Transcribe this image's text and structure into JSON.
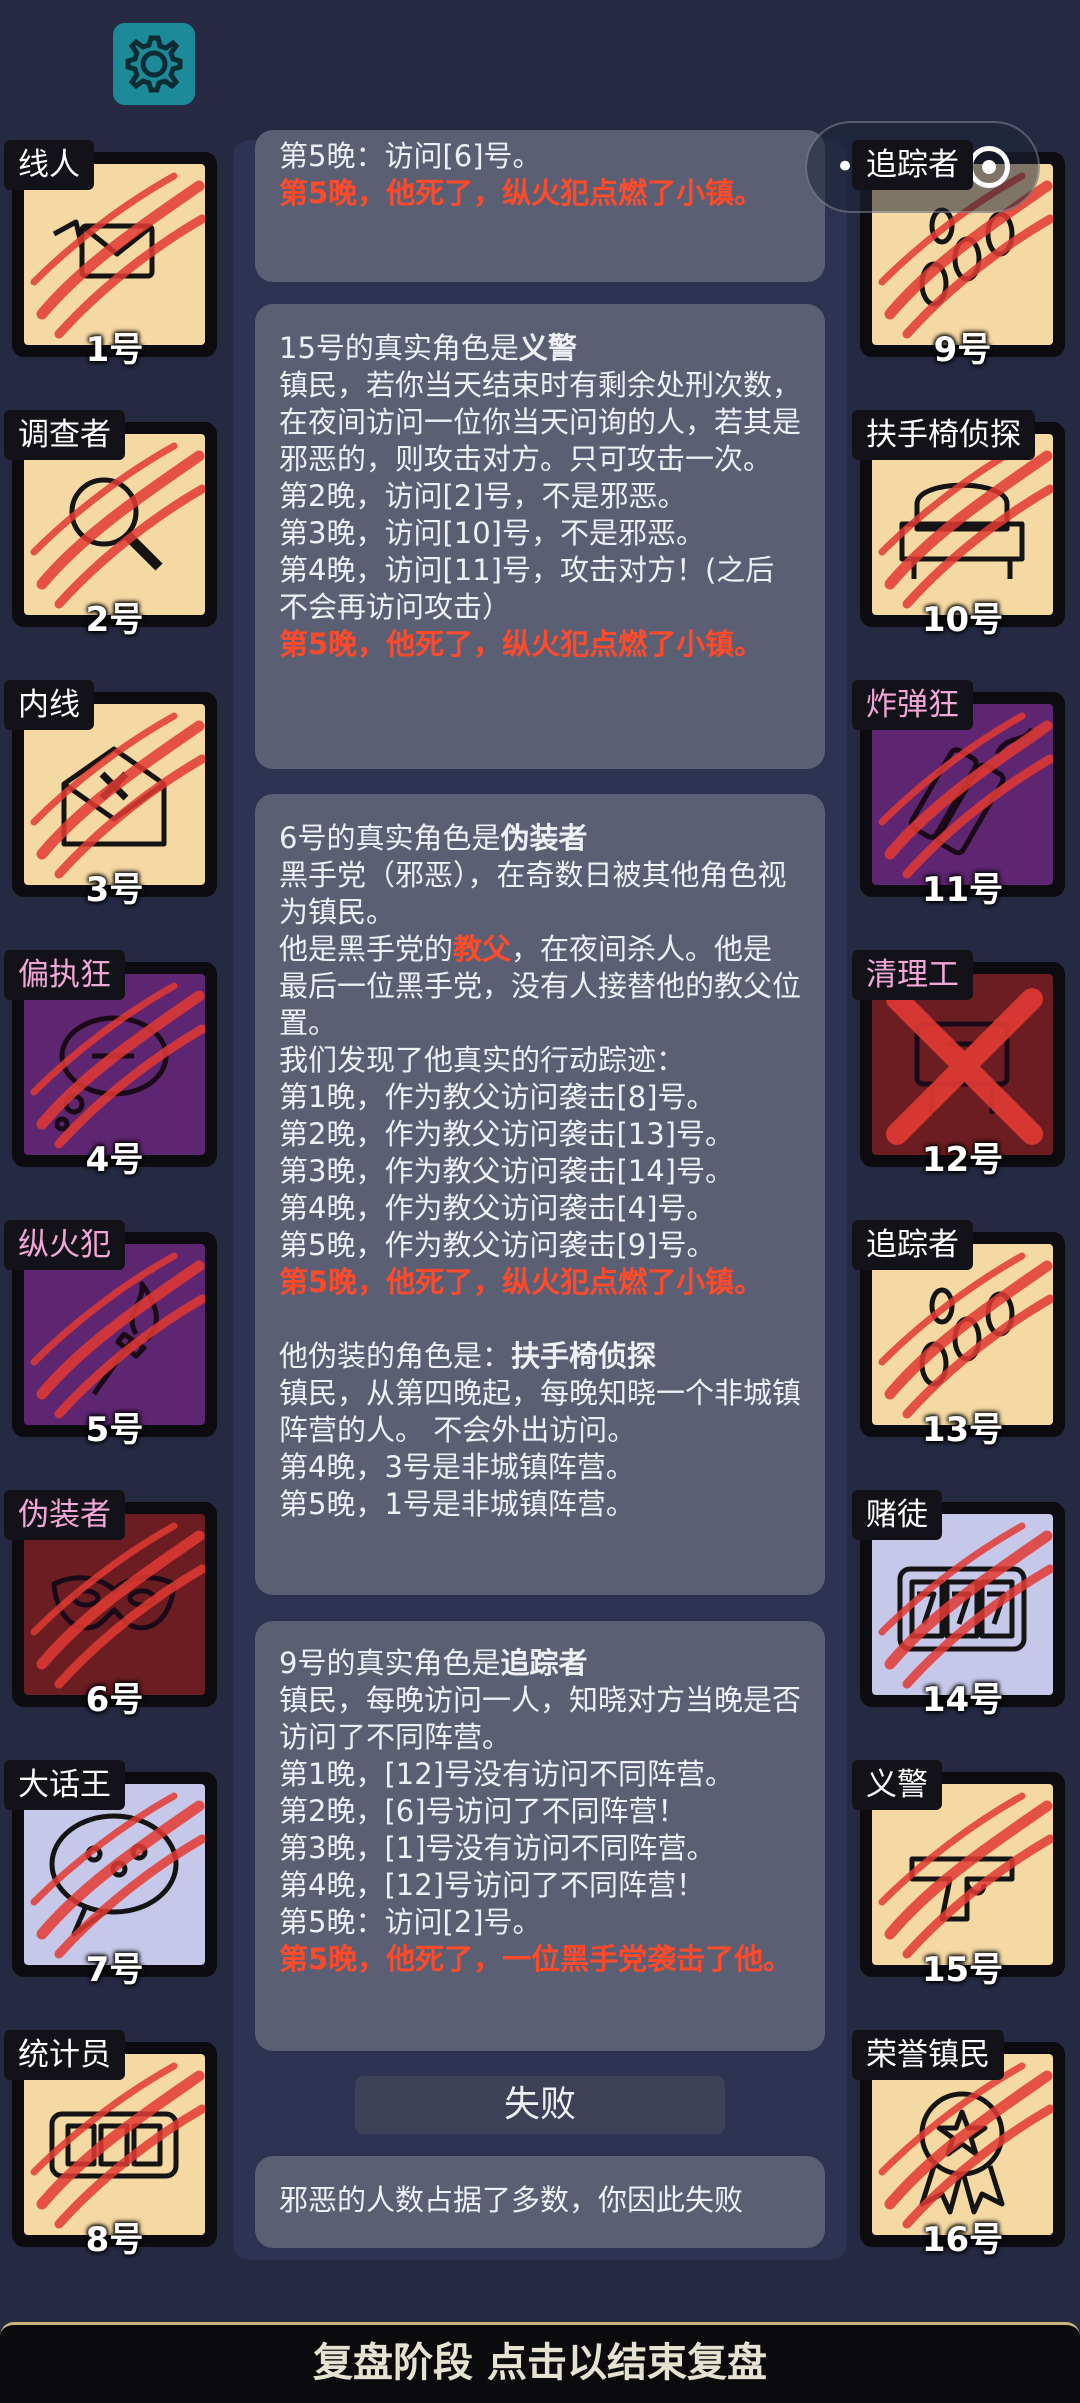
{
  "settings_icon": "gear-icon",
  "capsule": {
    "more": "•••",
    "record_icon": "record-icon"
  },
  "colors": {
    "beige": "#f5d9a3",
    "purple": "#5e2570",
    "maroon": "#6b1d22",
    "lavender": "#c6c8ea",
    "scratch": "#e23a33",
    "teal": "#1d8a99"
  },
  "players_left": [
    {
      "role": "线人",
      "num": "1号",
      "icon": "envelope-icon",
      "bg": "beige",
      "role_color": "#ffffff"
    },
    {
      "role": "调查者",
      "num": "2号",
      "icon": "magnifier-icon",
      "bg": "beige",
      "role_color": "#ffffff"
    },
    {
      "role": "内线",
      "num": "3号",
      "icon": "opened-envelope-icon",
      "bg": "beige",
      "role_color": "#ffffff"
    },
    {
      "role": "偏执狂",
      "num": "4号",
      "icon": "thought-bubble-icon",
      "bg": "purple",
      "role_color": "#f3a6d8"
    },
    {
      "role": "纵火犯",
      "num": "5号",
      "icon": "torch-icon",
      "bg": "purple",
      "role_color": "#f3a6d8"
    },
    {
      "role": "伪装者",
      "num": "6号",
      "icon": "mask-icon",
      "bg": "maroon",
      "role_color": "#f3a6d8"
    },
    {
      "role": "大话王",
      "num": "7号",
      "icon": "speech-bubble-icon",
      "bg": "lavender",
      "role_color": "#ffffff"
    },
    {
      "role": "统计员",
      "num": "8号",
      "icon": "counter-icon",
      "bg": "beige",
      "role_color": "#ffffff"
    }
  ],
  "players_right": [
    {
      "role": "追踪者",
      "num": "9号",
      "icon": "footprints-icon",
      "bg": "beige",
      "role_color": "#ffffff"
    },
    {
      "role": "扶手椅侦探",
      "num": "10号",
      "icon": "armchair-icon",
      "bg": "beige",
      "role_color": "#ffffff"
    },
    {
      "role": "炸弹狂",
      "num": "11号",
      "icon": "dynamite-icon",
      "bg": "purple",
      "role_color": "#f3a6d8"
    },
    {
      "role": "清理工",
      "num": "12号",
      "icon": "cleaner-icon",
      "bg": "maroon",
      "role_color": "#f3a6d8"
    },
    {
      "role": "追踪者",
      "num": "13号",
      "icon": "footprints-icon",
      "bg": "beige",
      "role_color": "#ffffff"
    },
    {
      "role": "赌徒",
      "num": "14号",
      "icon": "slot-machine-icon",
      "bg": "lavender",
      "role_color": "#ffffff"
    },
    {
      "role": "义警",
      "num": "15号",
      "icon": "pistol-icon",
      "bg": "beige",
      "role_color": "#ffffff"
    },
    {
      "role": "荣誉镇民",
      "num": "16号",
      "icon": "medal-icon",
      "bg": "beige",
      "role_color": "#ffffff"
    }
  ],
  "log": {
    "m0": {
      "l1": "第5晚：访问[6]号。",
      "death": "第5晚，他死了，纵火犯点燃了小镇。"
    },
    "m1": {
      "head": "15号的真实角色是",
      "role": "义警",
      "l1": "镇民，若你当天结束时有剩余处刑次数，在夜间访问一位你当天问询的人，若其是邪恶的，则攻击对方。只可攻击一次。",
      "l2": "第2晚，访问[2]号，不是邪恶。",
      "l3": "第3晚，访问[10]号，不是邪恶。",
      "l4": "第4晚，访问[11]号，攻击对方！(之后不会再访问攻击）",
      "death": "第5晚，他死了，纵火犯点燃了小镇。"
    },
    "m2": {
      "head": "6号的真实角色是",
      "role": "伪装者",
      "l1": "黑手党（邪恶），在奇数日被其他角色视为镇民。",
      "l2a": "他是黑手党的",
      "l2b": "教父",
      "l2c": "，在夜间杀人。他是最后一位黑手党，没有人接替他的教父位置。",
      "l3": "我们发现了他真实的行动踪迹：",
      "l4": "第1晚，作为教父访问袭击[8]号。",
      "l5": "第2晚，作为教父访问袭击[13]号。",
      "l6": "第3晚，作为教父访问袭击[14]号。",
      "l7": "第4晚，作为教父访问袭击[4]号。",
      "l8": "第5晚，作为教父访问袭击[9]号。",
      "death": "第5晚，他死了，纵火犯点燃了小镇。",
      "fake_head": "他伪装的角色是：",
      "fake_role": "扶手椅侦探",
      "f1": "镇民，从第四晚起，每晚知晓一个非城镇阵营的人。 不会外出访问。",
      "f2": "第4晚，3号是非城镇阵营。",
      "f3": "第5晚，1号是非城镇阵营。"
    },
    "m3": {
      "head": "9号的真实角色是",
      "role": "追踪者",
      "l1": "镇民，每晚访问一人，知晓对方当晚是否访问了不同阵营。",
      "l2": "第1晚，[12]号没有访问不同阵营。",
      "l3": "第2晚，[6]号访问了不同阵营！",
      "l4": "第3晚，[1]号没有访问不同阵营。",
      "l5": "第4晚，[12]号访问了不同阵营！",
      "l6": "第5晚：访问[2]号。",
      "death": "第5晚，他死了，一位黑手党袭击了他。"
    },
    "fail_label": "失败",
    "result": "邪恶的人数占据了多数，你因此失败"
  },
  "bottom_bar": "复盘阶段 点击以结束复盘"
}
